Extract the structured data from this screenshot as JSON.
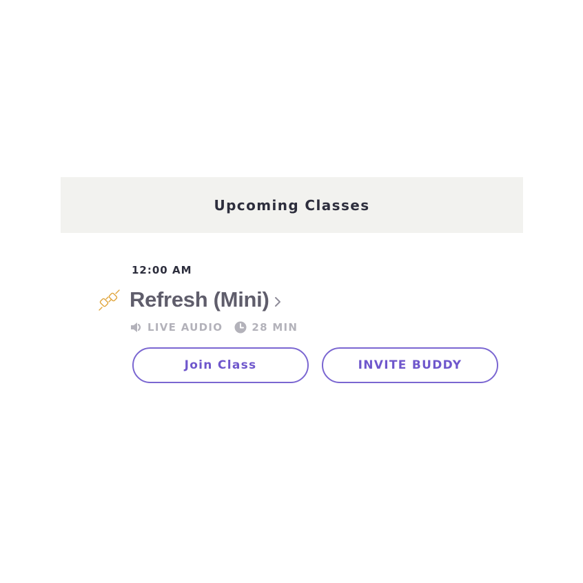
{
  "section": {
    "title": "Upcoming Classes"
  },
  "class_item": {
    "time": "12:00 AM",
    "title": "Refresh (Mini)",
    "category_icon": "plug-icon",
    "meta": {
      "type_icon": "speaker-icon",
      "type_label": "LIVE AUDIO",
      "duration_icon": "clock-icon",
      "duration_label": "28 MIN"
    },
    "join_label": "Join Class",
    "invite_label": "INVITE BUDDY"
  },
  "colors": {
    "header_bg": "#f2f2ef",
    "heading_text": "#2d2e3d",
    "title_text": "#5f5d6b",
    "meta_text": "#b3b2ba",
    "accent": "#7a66d1",
    "plug_icon": "#e0a43a"
  }
}
